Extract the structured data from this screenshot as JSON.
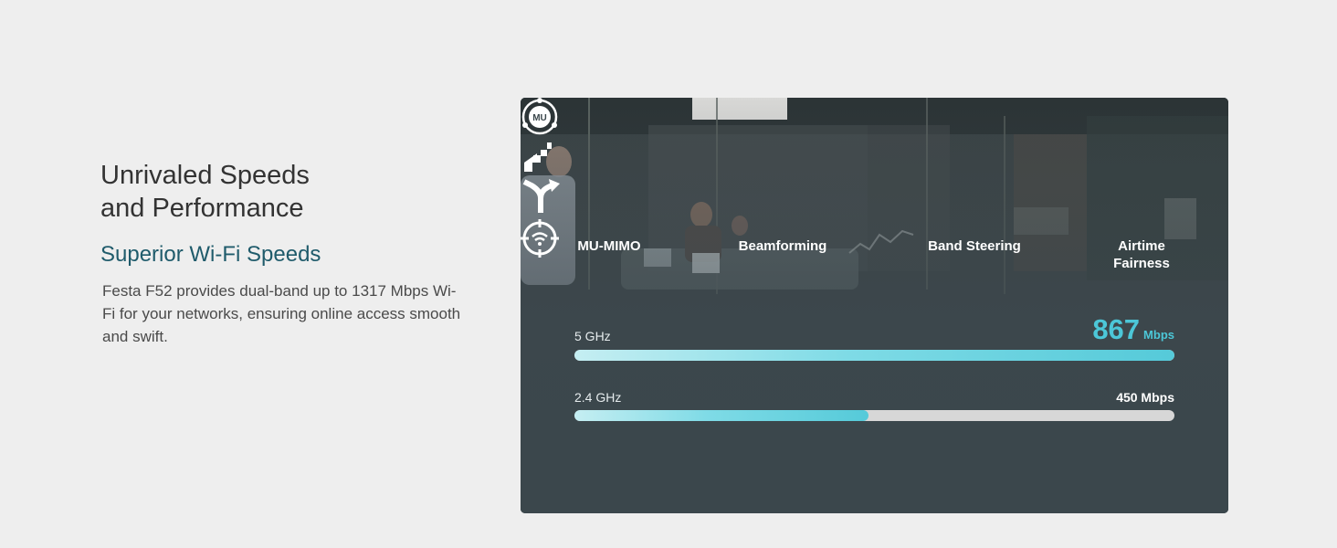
{
  "left": {
    "headline_line1": "Unrivaled Speeds",
    "headline_line2": "and Performance",
    "subhead": "Superior Wi-Fi Speeds",
    "description": "Festa F52 provides dual-band up to 1317 Mbps Wi-Fi for your networks, ensuring online access smooth and swift."
  },
  "features": [
    {
      "label": "MU-MIMO",
      "icon": "mu-mimo-icon",
      "icon_text": "MU"
    },
    {
      "label": "Beamforming",
      "icon": "beamforming-icon"
    },
    {
      "label": "Band Steering",
      "icon": "band-steering-icon"
    },
    {
      "label_line1": "Airtime",
      "label_line2": "Fairness",
      "icon": "airtime-fairness-icon"
    }
  ],
  "bands": [
    {
      "label": "5 GHz",
      "speed": "867",
      "unit": "Mbps",
      "fill_fraction": 1.0
    },
    {
      "label": "2.4 GHz",
      "speed_text": "450 Mbps",
      "fill_fraction": 0.49
    }
  ],
  "colors": {
    "accent": "#4cc7d8",
    "subhead": "#1f5b6b",
    "card_bg": "#3b474c"
  }
}
